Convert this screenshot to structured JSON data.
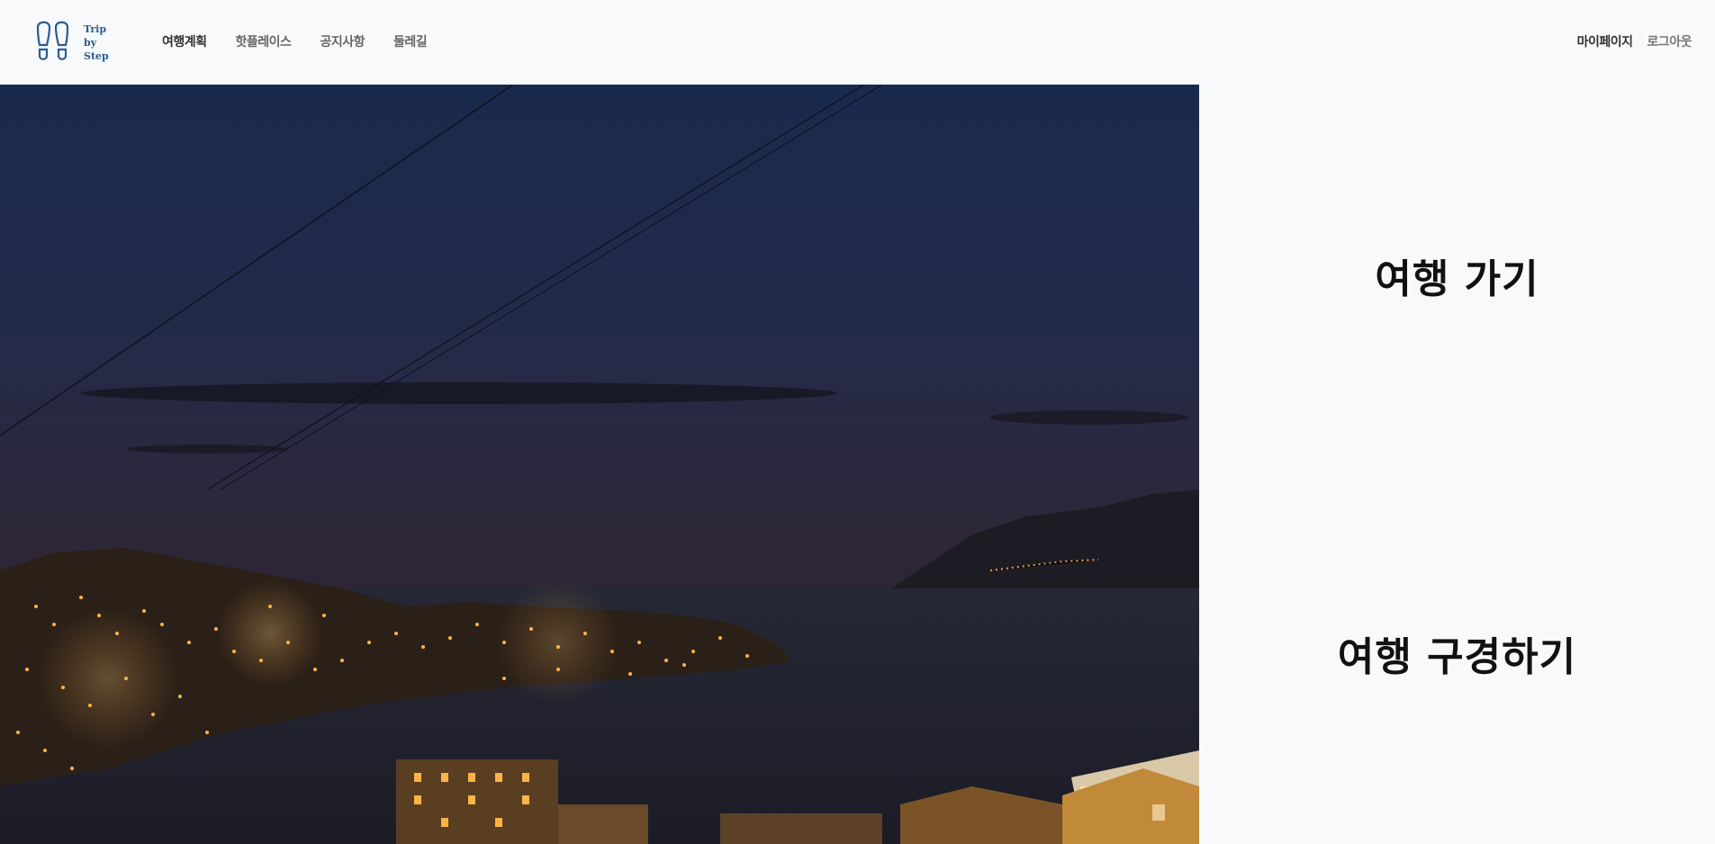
{
  "header": {
    "logo": {
      "line1": "Trip",
      "line2": "by",
      "line3": "Step",
      "icon": "footprints-icon"
    },
    "nav": [
      {
        "label": "여행계획"
      },
      {
        "label": "핫플레이스"
      },
      {
        "label": "공지사항"
      },
      {
        "label": "둘레길"
      }
    ],
    "user_nav": {
      "mypage": "마이페이지",
      "logout": "로그아웃"
    }
  },
  "hero": {
    "image": "night-harbor-city-photo"
  },
  "side": {
    "go_trip": "여행 가기",
    "browse_trip": "여행 구경하기"
  },
  "colors": {
    "brand": "#2a5d8f",
    "background": "#f8f9fb",
    "text_dark": "#111111"
  }
}
